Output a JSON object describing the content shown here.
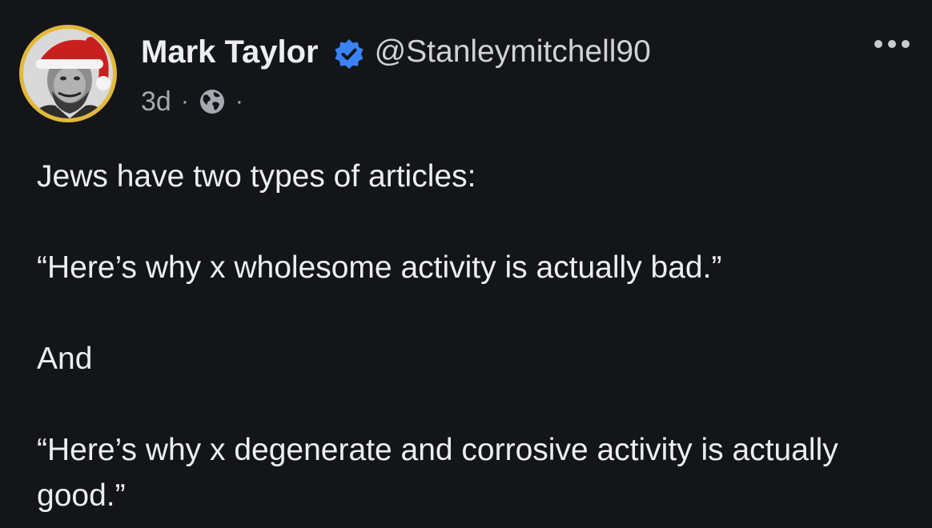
{
  "post": {
    "author_name": "Mark Taylor",
    "handle": "@Stanleymitchell90",
    "timestamp": "3d",
    "separator": "·",
    "lines": [
      "Jews have two types of articles:",
      "“Here’s why x wholesome activity is actually bad.”",
      "And",
      "“Here’s why x degenerate and corrosive activity is actually good.”"
    ]
  },
  "icons": {
    "verified": "verified-badge-icon",
    "visibility": "globe-icon",
    "more": "more-options-icon"
  },
  "colors": {
    "background": "#141519",
    "verified_blue": "#3b82f6",
    "avatar_ring": "#e3b93a",
    "text": "#eceef2",
    "secondary_text": "#a7a9b0"
  }
}
